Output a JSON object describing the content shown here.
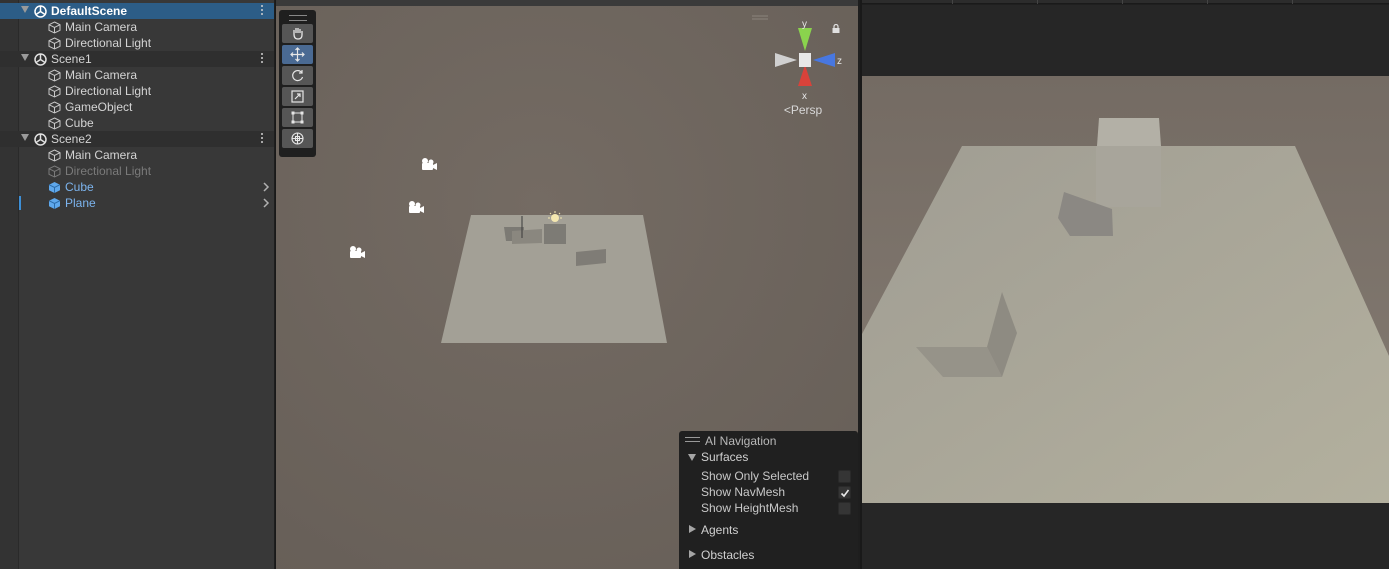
{
  "hierarchy": {
    "scenes": [
      {
        "name": "DefaultScene",
        "selected": true,
        "children": [
          "Main Camera",
          "Directional Light"
        ]
      },
      {
        "name": "Scene1",
        "selected": false,
        "children": [
          "Main Camera",
          "Directional Light",
          "GameObject",
          "Cube"
        ]
      },
      {
        "name": "Scene2",
        "selected": false,
        "children": [
          "Main Camera",
          "Directional Light",
          "Cube",
          "Plane"
        ]
      }
    ],
    "disabled_items": [
      "Scene2/Directional Light"
    ],
    "prefab_items": [
      "Scene2/Cube",
      "Scene2/Plane"
    ]
  },
  "scene_view": {
    "tools": [
      "hand-tool",
      "move-tool",
      "rotate-tool",
      "scale-tool",
      "rect-tool",
      "transform-tool"
    ],
    "active_tool": "move-tool",
    "gizmo": {
      "y": "y",
      "x": "x",
      "z": "z",
      "projection": "Persp"
    }
  },
  "ai_navigation": {
    "title": "AI Navigation",
    "surfaces": {
      "label": "Surfaces",
      "options": [
        {
          "label": "Show Only Selected",
          "checked": false
        },
        {
          "label": "Show NavMesh",
          "checked": true
        },
        {
          "label": "Show HeightMesh",
          "checked": false
        }
      ]
    },
    "agents_label": "Agents",
    "obstacles_label": "Obstacles"
  },
  "colors": {
    "selection": "#2c5d87",
    "prefab_text": "#7cb4ee",
    "scene_bg": "#6e665f",
    "plane": "#a3a096"
  }
}
